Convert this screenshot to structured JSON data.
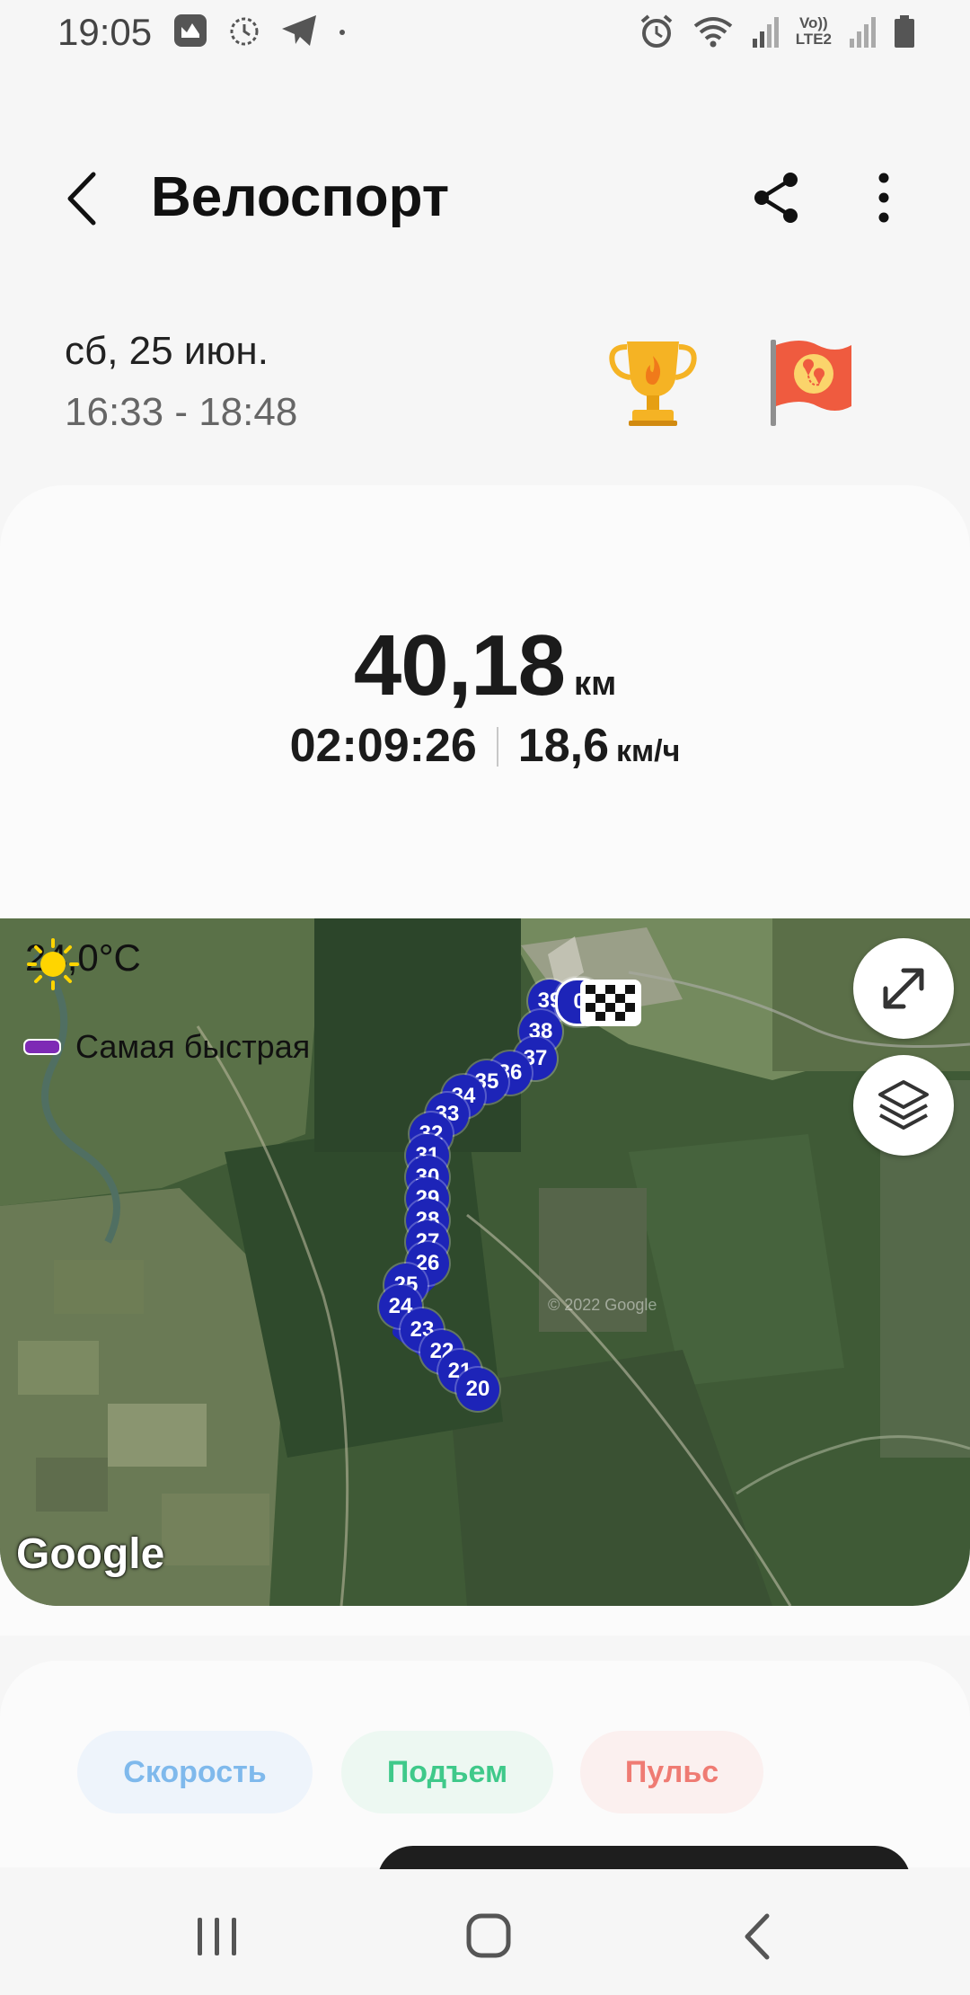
{
  "status_bar": {
    "time": "19:05",
    "left_icons": [
      "gallery-icon",
      "alarm-clock-icon",
      "telegram-icon",
      "dot-icon"
    ],
    "right_icons": [
      "alarm-icon",
      "wifi-icon",
      "signal-icon",
      "volte-lte2-icon",
      "signal-icon",
      "battery-icon"
    ],
    "lte_label": "LTE2",
    "volte_label": "Vo))"
  },
  "header": {
    "title": "Велоспорт"
  },
  "session": {
    "date": "сб, 25 июн.",
    "time_range": "16:33 - 18:48"
  },
  "stats": {
    "distance": "40,18",
    "distance_unit": "км",
    "duration": "02:09:26",
    "avg_speed": "18,6",
    "avg_speed_unit": "км/ч"
  },
  "map": {
    "weather_temp": "24,0°C",
    "legend_label": "Самая быстрая",
    "legend_color": "#7e2ab5",
    "google_label": "Google",
    "copyright": "© 2022 Google",
    "route_color": "#1d24b8",
    "route_markers": [
      "39",
      "0",
      "38",
      "37",
      "36",
      "35",
      "34",
      "33",
      "32",
      "31",
      "30",
      "29",
      "28",
      "27",
      "26",
      "25",
      "24",
      "23",
      "22",
      "21",
      "20"
    ]
  },
  "tabs": [
    {
      "label": "Скорость",
      "color": "#7fb9ec"
    },
    {
      "label": "Подъем",
      "color": "#3fc98a"
    },
    {
      "label": "Пульс",
      "color": "#ef7b73"
    }
  ],
  "navbar": {
    "icons": [
      "recent-apps-icon",
      "home-icon",
      "back-icon"
    ]
  }
}
